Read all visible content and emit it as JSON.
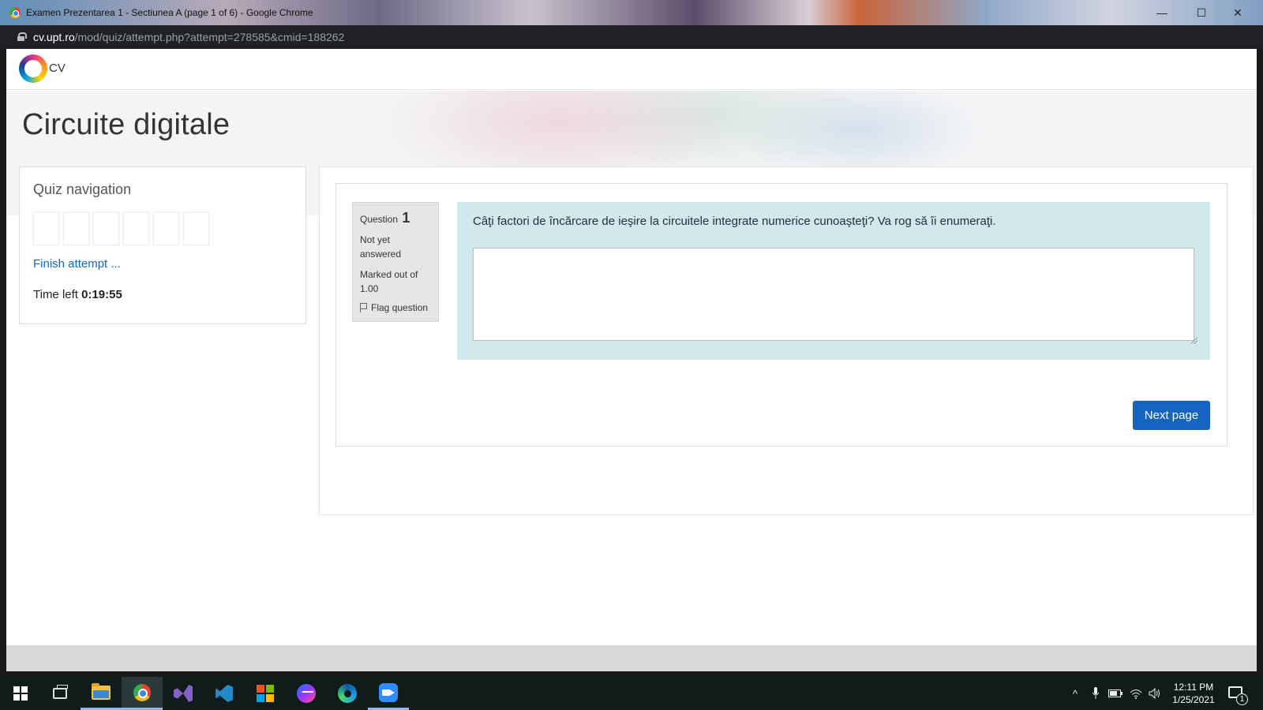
{
  "window": {
    "title": "Examen Prezentarea 1 - Sectiunea A (page 1 of 6) - Google Chrome",
    "minimize_glyph": "—",
    "maximize_glyph": "☐",
    "close_glyph": "✕"
  },
  "address_bar": {
    "host": "cv.upt.ro",
    "path": "/mod/quiz/attempt.php?attempt=278585&cmid=188262"
  },
  "site": {
    "logo_text": "CV"
  },
  "course": {
    "title": "Circuite digitale"
  },
  "quiz_nav": {
    "heading": "Quiz navigation",
    "buttons": [
      "",
      "",
      "",
      "",
      "",
      ""
    ],
    "finish_label": "Finish attempt ...",
    "time_label": "Time left",
    "time_value": "0:19:55"
  },
  "question": {
    "label": "Question",
    "number": "1",
    "state": "Not yet answered",
    "grade": "Marked out of 1.00",
    "flag_label": "Flag question",
    "text": "Câţi factori de încărcare de ieşire la circuitele integrate numerice cunoaşteţi? Va rog să îi enumeraţi.",
    "answer_value": ""
  },
  "navigation": {
    "next_label": "Next page"
  },
  "taskbar": {
    "items": [
      "start",
      "task-view",
      "file-explorer",
      "chrome",
      "visual-studio",
      "vscode",
      "office",
      "messenger",
      "edge",
      "zoom"
    ],
    "active": "chrome",
    "tray_chevron": "^",
    "time": "12:11 PM",
    "date": "1/25/2021",
    "notification_count": "1"
  },
  "colors": {
    "accent": "#1565c0",
    "question_bg": "#d1e8ec",
    "info_bg": "#e6e6e6",
    "address_bar_bg": "#202124",
    "taskbar_bg": "#101c1a"
  }
}
